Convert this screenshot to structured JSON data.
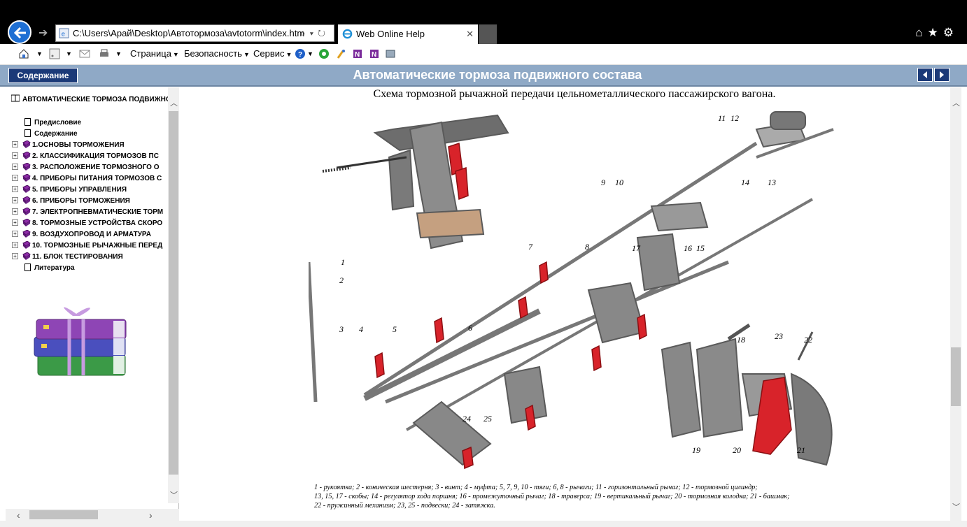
{
  "browser": {
    "address": "C:\\Users\\Арай\\Desktop\\Автотормоза\\avtotorm\\index.htm",
    "tab_title": "Web Online Help",
    "icons": {
      "back": "back-arrow-icon",
      "forward": "forward-arrow-icon",
      "search": "search-icon",
      "refresh": "refresh-icon",
      "home": "home-icon",
      "favorites": "star-icon",
      "settings": "gear-icon"
    }
  },
  "commandbar": {
    "page": "Страница",
    "safety": "Безопасность",
    "service": "Сервис"
  },
  "help": {
    "toc_button": "Содержание",
    "title": "Автоматические тормоза подвижного состава"
  },
  "tree": {
    "root": "АВТОМАТИЧЕСКИЕ ТОРМОЗА ПОДВИЖНОГО",
    "items": [
      {
        "label": "Предисловие",
        "type": "page"
      },
      {
        "label": "Содержание",
        "type": "page"
      },
      {
        "label": " 1.ОСНОВЫ ТОРМОЖЕНИЯ",
        "type": "book"
      },
      {
        "label": " 2. КЛАССИФИКАЦИЯ ТОРМОЗОВ ПС",
        "type": "book"
      },
      {
        "label": " 3. РАСПОЛОЖЕНИЕ ТОРМОЗНОГО О",
        "type": "book"
      },
      {
        "label": " 4. ПРИБОРЫ ПИТАНИЯ ТОРМОЗОВ С",
        "type": "book"
      },
      {
        "label": "5. ПРИБОРЫ УПРАВЛЕНИЯ",
        "type": "book"
      },
      {
        "label": "6. ПРИБОРЫ ТОРМОЖЕНИЯ",
        "type": "book"
      },
      {
        "label": "7. ЭЛЕКТРОПНЕВМАТИЧЕСКИЕ ТОРМ",
        "type": "book"
      },
      {
        "label": "8. ТОРМОЗНЫЕ УСТРОЙСТВА СКОРО",
        "type": "book"
      },
      {
        "label": "9. ВОЗДУХОПРОВОД И АРМАТУРА",
        "type": "book"
      },
      {
        "label": "10. ТОРМОЗНЫЕ РЫЧАЖНЫЕ ПЕРЕД",
        "type": "book"
      },
      {
        "label": "11. БЛОК ТЕСТИРОВАНИЯ",
        "type": "book"
      },
      {
        "label": "Литература",
        "type": "page"
      }
    ]
  },
  "content": {
    "caption": "Схема тормозной рычажной передачи цельнометаллического пассажирского вагона.",
    "labels": [
      "1",
      "2",
      "3",
      "4",
      "5",
      "6",
      "7",
      "8",
      "9",
      "10",
      "11",
      "12",
      "13",
      "14",
      "15",
      "16",
      "17",
      "18",
      "19",
      "20",
      "21",
      "22",
      "23",
      "24",
      "25"
    ],
    "legend_line1": "1 - рукоятка; 2 - коническая шестерня; 3 - винт; 4 - муфта; 5, 7, 9, 10 - тяги; 6, 8 - рычаги; 11  - горизонтальный рычаг; 12 - тормозной цилиндр;",
    "legend_line2": "13, 15, 17 - скобы; 14 - регулятор хода поршня; 16 - промежуточный рычаг; 18 - траверса; 19 - вертикальный рычаг; 20 - тормозная колодка; 21 - башмак;",
    "legend_line3": "22 - пружинный механизм; 23, 25 - подвески; 24 - затяжка."
  },
  "colors": {
    "header": "#8fa9c6",
    "button": "#1b3a78",
    "accent": "#1e6fd3",
    "brake_shoe": "#d8232a"
  }
}
